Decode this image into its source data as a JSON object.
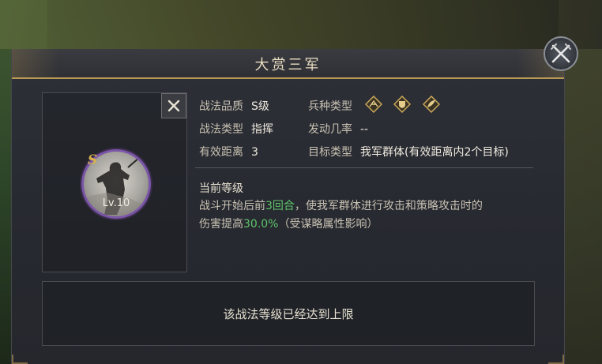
{
  "title": "大赏三军",
  "grade_badge": "S",
  "level_label": "Lv.10",
  "info": {
    "quality_label": "战法品质",
    "quality_value": "S级",
    "troop_type_label": "兵种类型",
    "tactic_type_label": "战法类型",
    "tactic_type_value": "指挥",
    "trigger_rate_label": "发动几率",
    "trigger_rate_value": "--",
    "range_label": "有效距离",
    "range_value": "3",
    "target_label": "目标类型",
    "target_value": "我军群体(有效距离内2个目标)"
  },
  "troop_icons": [
    "cavalry-icon",
    "shield-icon",
    "archer-icon"
  ],
  "level_section": {
    "title": "当前等级",
    "desc_1": "战斗开始后前",
    "desc_highlight_1": "3回合",
    "desc_2": "，使我军群体进行攻击和策略攻击时的",
    "desc_3": "伤害提高",
    "desc_highlight_2": "30.0%",
    "desc_4": "（受谋略属性影响）"
  },
  "max_level_notice": "该战法等级已经达到上限",
  "colors": {
    "accent_gold": "#b89a55",
    "highlight_green": "#5fc46a",
    "avatar_ring": "#7a55a8"
  }
}
